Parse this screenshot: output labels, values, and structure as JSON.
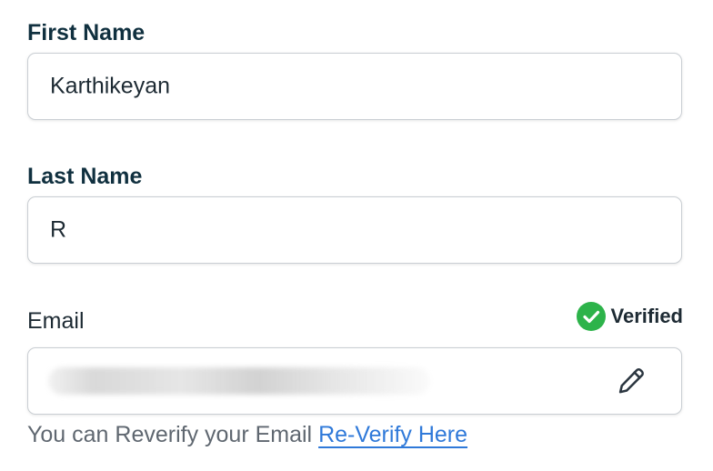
{
  "form": {
    "first_name": {
      "label": "First Name",
      "value": "Karthikeyan"
    },
    "last_name": {
      "label": "Last Name",
      "value": "R"
    },
    "email": {
      "label": "Email",
      "value": "",
      "status": {
        "icon": "check-circle-icon",
        "label": "Verified",
        "color": "#2db34a"
      },
      "edit_icon": "pencil-icon",
      "helper_text": "You can Reverify your Email",
      "reverify_link": "Re-Verify Here"
    }
  },
  "colors": {
    "label": "#10303f",
    "text": "#1d2a33",
    "helper": "#5f6770",
    "link": "#2f79d9",
    "border": "#c9ced3",
    "verified": "#2db34a"
  }
}
